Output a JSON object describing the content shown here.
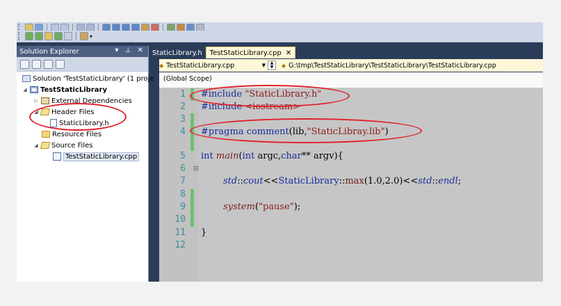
{
  "solution_explorer": {
    "title": "Solution Explorer",
    "header_controls": "▾ ⊥ ✕",
    "tree": {
      "solution": "Solution 'TestStaticLibrary' (1 proje",
      "project": "TestStaticLibrary",
      "external_dependencies": "External Dependencies",
      "header_files": "Header Files",
      "header_file_1": "StaticLibrary.h",
      "resource_files": "Resource Files",
      "source_files": "Source Files",
      "source_file_1": "TestStaticLibrary.cpp"
    }
  },
  "tabs": [
    {
      "label": "StaticLibrary.h",
      "active": false
    },
    {
      "label": "TestStaticLibrary.cpp",
      "active": true
    }
  ],
  "tab_close_symbol": "✕",
  "navigation": {
    "file_dropdown": "TestStaticLibrary.cpp",
    "path": "G:\\tmp\\TestStaticLibrary\\TestStaticLibrary\\TestStaticLibrary.cpp",
    "scope": "(Global Scope)"
  },
  "code": {
    "line_numbers": [
      "1",
      "2",
      "3",
      "4",
      "5",
      "6",
      "7",
      "8",
      "9",
      "10",
      "11",
      "12"
    ],
    "l1_directive": "#include",
    "l1_string": "\"StaticLibrary.h\"",
    "l2_directive": "#include",
    "l2_header": "<iostream>",
    "l4_directive": "#pragma",
    "l4_comment": "comment",
    "l4_open": "(lib,",
    "l4_string": "\"StaticLibray.lib\"",
    "l4_close": ")",
    "l6_int": "int",
    "l6_main": "main",
    "l6_open": "(",
    "l6_int2": "int",
    "l6_argc": "argc,",
    "l6_char": "char",
    "l6_rest": "** argv){",
    "l8_std1": "std",
    "l8_sep1": "::",
    "l8_cout": "cout",
    "l8_op1": "<<",
    "l8_class": "StaticLibrary",
    "l8_sep2": "::",
    "l8_max": "max",
    "l8_args": "(1.0,2.0)",
    "l8_op2": "<<",
    "l8_std2": "std",
    "l8_sep3": "::",
    "l8_endl": "endl",
    "l8_semi": ";",
    "l10_system": "system",
    "l10_open": "(",
    "l10_string": "\"pause\"",
    "l10_close": ");",
    "l12": "}"
  },
  "colors": {
    "annotation": "#e0202a",
    "change_marker": "#6ec06e",
    "explorer_header": "#4d6082",
    "active_tab": "#fff8d8"
  },
  "icons": [
    "solution-icon",
    "project-icon",
    "references-icon",
    "folder-icon",
    "header-file-icon",
    "cpp-file-icon"
  ]
}
